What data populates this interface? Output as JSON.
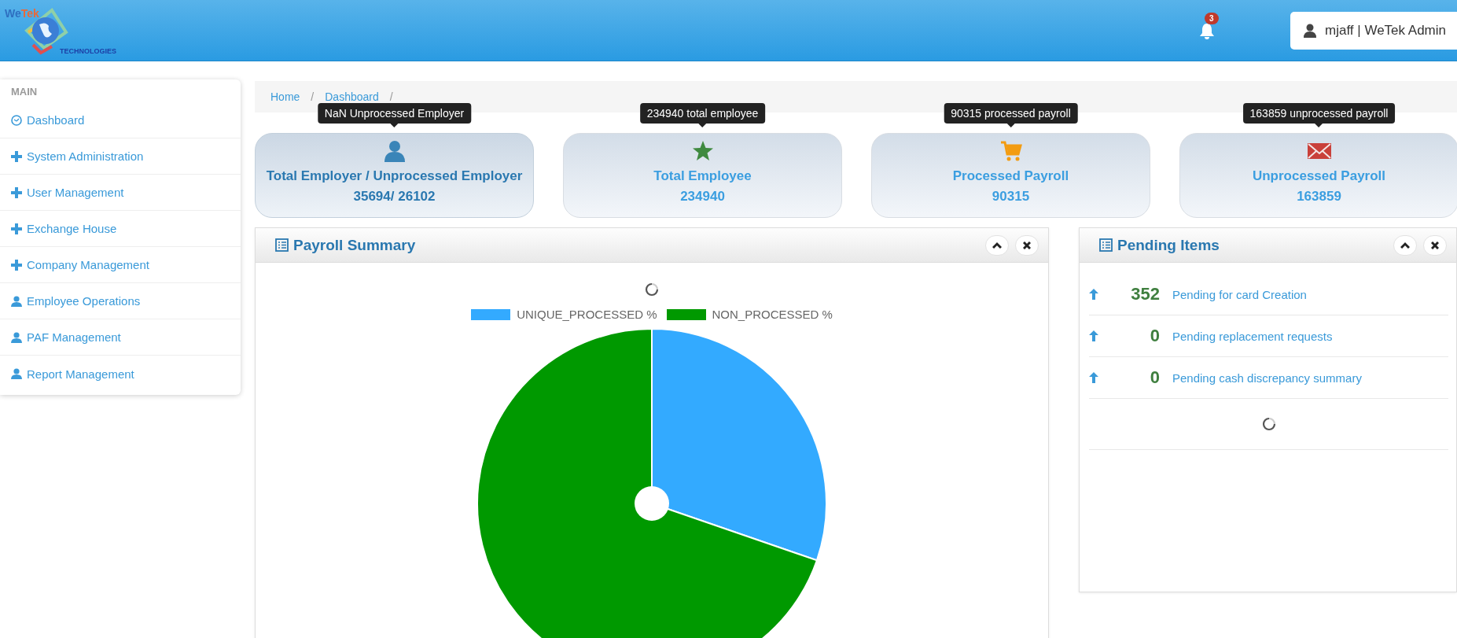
{
  "logo": {
    "wordmark": [
      "We",
      "Tek"
    ],
    "tagline": "TECHNOLOGIES"
  },
  "notifications": {
    "count": "3"
  },
  "user_menu": {
    "label": "mjaff | WeTek Admin"
  },
  "sidebar": {
    "heading": "MAIN",
    "items": [
      {
        "label": "Dashboard",
        "kind": "dashboard"
      },
      {
        "label": "System Administration",
        "kind": "expandable"
      },
      {
        "label": "User Management",
        "kind": "expandable"
      },
      {
        "label": "Exchange House",
        "kind": "expandable"
      },
      {
        "label": "Company Management",
        "kind": "expandable"
      },
      {
        "label": "Employee Operations",
        "kind": "person"
      },
      {
        "label": "PAF Management",
        "kind": "person"
      },
      {
        "label": "Report Management",
        "kind": "person"
      }
    ]
  },
  "breadcrumb": [
    {
      "label": "Home",
      "separator": "/"
    },
    {
      "label": "Dashboard",
      "separator": "/"
    }
  ],
  "cards": [
    {
      "tooltip": "NaN Unprocessed Employer",
      "kind": "employer",
      "title": "Total Employer / Unprocessed Employer",
      "value": "35694/ 26102",
      "highlighted": true
    },
    {
      "tooltip": "234940 total employee",
      "kind": "employee",
      "title": "Total Employee",
      "value": "234940",
      "highlighted": false
    },
    {
      "tooltip": "90315 processed payroll",
      "kind": "processed",
      "title": "Processed Payroll",
      "value": "90315",
      "highlighted": false
    },
    {
      "tooltip": "163859 unprocessed payroll",
      "kind": "unprocessed",
      "title": "Unprocessed Payroll",
      "value": "163859",
      "highlighted": false
    }
  ],
  "payroll_summary": {
    "title": "Payroll Summary",
    "legend": [
      {
        "label": "UNIQUE_PROCESSED %",
        "color": "#33aaff"
      },
      {
        "label": "NON_PROCESSED %",
        "color": "#009900"
      }
    ]
  },
  "pending_items": {
    "title": "Pending Items",
    "rows": [
      {
        "count": "352",
        "label": "Pending for card Creation"
      },
      {
        "count": "0",
        "label": "Pending replacement requests"
      },
      {
        "count": "0",
        "label": "Pending cash discrepancy summary"
      }
    ]
  }
}
